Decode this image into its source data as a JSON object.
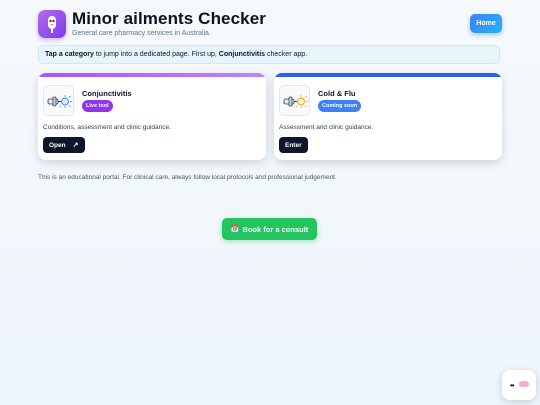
{
  "header": {
    "title": "Minor ailments Checker",
    "subtitle": "General care pharmacy services in Australia.",
    "home_label": "Home"
  },
  "banner": {
    "bold_lead": "Tap a category",
    "text_mid": " to jump into a dedicated page. First up, ",
    "bold_app": "Conjunctivitis",
    "text_end": " checker app."
  },
  "cards": [
    {
      "name": "Conjunctivitis",
      "badge": "Live tool",
      "description": "Conditions, assessment and clinic guidance.",
      "button": "Open",
      "button_icon": "↗",
      "accent": "#a855f7",
      "badge_color": "#9333ea",
      "icon": "eye-dropper-icon"
    },
    {
      "name": "Cold & Flu",
      "badge": "Coming soon",
      "description": "Assessment and clinic guidance.",
      "button": "Enter",
      "accent": "#2563eb",
      "badge_color": "#3b82f6",
      "icon": "virus-icon"
    }
  ],
  "disclaimer": "This is an educational portal. For clinical care, always follow local protocols and professional judgement.",
  "consult_button": {
    "icon": "📅",
    "label": "Book for a consult"
  },
  "colors": {
    "consult": "#22c55e",
    "home": "#3b82f6",
    "dark_button": "#0f172a"
  }
}
